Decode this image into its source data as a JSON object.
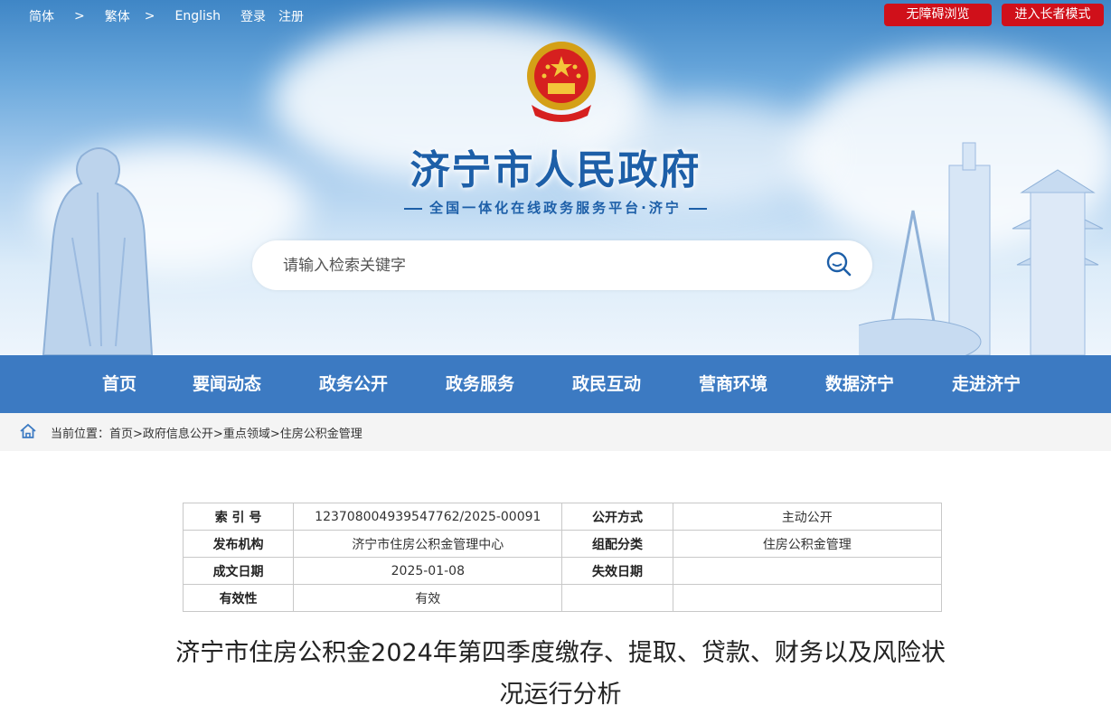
{
  "topbar": {
    "links": [
      "简体",
      ">",
      "繁体",
      ">",
      "English",
      "登录",
      "注册"
    ],
    "accessible_button": "无障碍浏览",
    "elderly_button": "进入长者模式"
  },
  "site": {
    "title": "济宁市人民政府",
    "subtitle": "全国一体化在线政务服务平台·济宁"
  },
  "search": {
    "placeholder": "请输入检索关键字"
  },
  "nav": {
    "items": [
      "首页",
      "要闻动态",
      "政务公开",
      "政务服务",
      "政民互动",
      "营商环境",
      "数据济宁",
      "走进济宁"
    ]
  },
  "breadcrumb": {
    "prefix": "当前位置：",
    "items": [
      "首页>",
      "政府信息公开>",
      "重点领域>",
      "住房公积金管理"
    ]
  },
  "info_table": {
    "rows": [
      [
        "索 引 号",
        "123708004939547762/2025-00091",
        "公开方式",
        "主动公开"
      ],
      [
        "发布机构",
        "济宁市住房公积金管理中心",
        "组配分类",
        "住房公积金管理"
      ],
      [
        "成文日期",
        "2025-01-08",
        "失效日期",
        ""
      ],
      [
        "有效性",
        "有效",
        "",
        ""
      ]
    ]
  },
  "article": {
    "title_line1": "济宁市住房公积金2024年第四季度缴存、提取、贷款、财务以及风险状",
    "title_line2": "况运行分析"
  },
  "colors": {
    "nav_bg": "#3c7ac2",
    "title_blue": "#1d5fa8",
    "red_button": "#d0101a"
  }
}
